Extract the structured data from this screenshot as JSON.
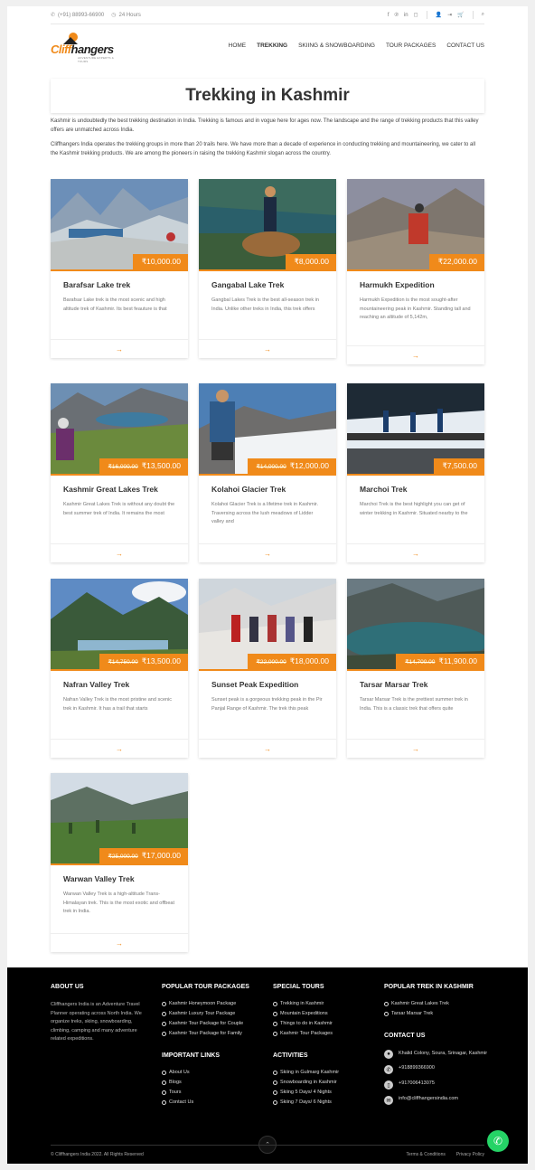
{
  "topbar": {
    "phone": "(+91) 88993-66900",
    "hours": "24 Hours"
  },
  "logo": {
    "part1": "Cliff",
    "part2": "hangers",
    "tagline": "ADVENTURE EXPERTS & TOURS"
  },
  "nav": [
    "HOME",
    "TREKKING",
    "SKIING & SNOWBOARDING",
    "TOUR PACKAGES",
    "CONTACT US"
  ],
  "page_title": "Trekking in Kashmir",
  "intro": [
    "Kashmir is undoubtedly the best trekking destination in India. Trekking is famous and in vogue here for ages now. The landscape and the range of trekking products that this valley offers are unmatched across India.",
    "Cliffhangers India operates the trekking groups in more than 20 trails here. We have more than a decade of experience in conducting trekking and mountaineering, we cater to all the Kashmir trekking products. We are among the pioneers in raising the trekking Kashmir slogan across the country."
  ],
  "treks": [
    {
      "title": "Barafsar Lake trek",
      "old": "",
      "price": "₹10,000.00",
      "desc": "Barafsar Lake trek is the most scenic and high altitude trek of Kashmir. Its best feauture is that",
      "more": "→"
    },
    {
      "title": "Gangabal Lake Trek",
      "old": "",
      "price": "₹8,000.00",
      "desc": "Gangbal Lakes Trek is the best all-season trek in India. Unlike other treks in India, this trek offers",
      "more": "→"
    },
    {
      "title": "Harmukh Expedition",
      "old": "",
      "price": "₹22,000.00",
      "desc": "Harmukh Expedition is the most sought-after mountaineering peak in Kashmir. Standing tall and reaching an altitude of 5,142m,",
      "more": "→"
    },
    {
      "title": "Kashmir Great Lakes Trek",
      "old": "₹16,000.00",
      "price": "₹13,500.00",
      "desc": "Kashmir Great Lakes Trek is without any doubt the best summer trek of India. It remains the most",
      "more": "→"
    },
    {
      "title": "Kolahoi Glacier Trek",
      "old": "₹14,000.00",
      "price": "₹12,000.00",
      "desc": "Kolahoi Glacier Trek is a lifetime trek in Kashmir. Traversing across the lush meadows of Lidder valley and",
      "more": "→"
    },
    {
      "title": "Marchoi Trek",
      "old": "",
      "price": "₹7,500.00",
      "desc": "Marchoi Trek is the best highlight you can get of winter trekking in Kashmir. Situated nearby to the",
      "more": "→"
    },
    {
      "title": "Nafran Valley Trek",
      "old": "₹14,750.00",
      "price": "₹13,500.00",
      "desc": "Nafran Valley Trek is the most pristine and scenic trek in Kashmir. It has a trail that starts",
      "more": "→"
    },
    {
      "title": "Sunset Peak Expedition",
      "old": "₹22,000.00",
      "price": "₹18,000.00",
      "desc": "Sunset peak is a gorgeous trekking peak in the Pir Panjal Range of Kashmir. The trek this peak",
      "more": "→"
    },
    {
      "title": "Tarsar Marsar Trek",
      "old": "₹14,700.00",
      "price": "₹11,900.00",
      "desc": "Tarsar Marsar Trek is the prettiest summer trek in India. This is a classic trek that offers quite",
      "more": "→"
    },
    {
      "title": "Warwan Valley Trek",
      "old": "₹25,000.00",
      "price": "₹17,000.00",
      "desc": "Warwan Valley Trek is a high-altitude Trans-Himalayan trek. This is the most exotic and offbeat trek in India.",
      "more": "→"
    }
  ],
  "footer": {
    "about_title": "ABOUT US",
    "about_text": "Cliffhangers India is an Adventure Travel Planner operating across North India. We organize treks, skiing, snowboarding, climbing, camping and many adventure related expeditions.",
    "popular_tours_title": "POPULAR TOUR PACKAGES",
    "popular_tours": [
      "Kashmir Honeymoon Package",
      "Kashmir Luxury Tour Package",
      "Kashmir Tour Package for Couple",
      "Kashmir Tour Package for Family"
    ],
    "special_title": "SPECIAL TOURS",
    "special": [
      "Trekking in Kashmir",
      "Mountain Expeditions",
      "Things to do in Kashmir",
      "Kashmir Tour Packages"
    ],
    "popular_trek_title": "POPULAR TREK IN KASHMIR",
    "popular_trek": [
      "Kashmir Great Lakes Trek",
      "Tarsar Marsar Trek"
    ],
    "important_title": "IMPORTANT LINKS",
    "important": [
      "About Us",
      "Blogs",
      "Tours",
      "Contact Us"
    ],
    "activities_title": "ACTIVITIES",
    "activities": [
      "Skiing in Gulmarg Kashmir",
      "Snowboarding in Kashmir",
      "Skiing 5 Days/ 4 Nights",
      "Skiing 7 Days/ 6 Nights"
    ],
    "contact_title": "CONTACT US",
    "address": "Khalid Colony, Soura, Srinagar, Kashmir",
    "phone1": "+918899366900",
    "phone2": "+917006413075",
    "email": "info@cliffhangersindia.com",
    "copyright": "© Cliffhangers India 2022. All Rights Reserved",
    "terms": "Terms & Conditions",
    "privacy": "Privacy Policy"
  },
  "colors": {
    "accent": "#f08a1a",
    "footer_bg": "#000000"
  }
}
